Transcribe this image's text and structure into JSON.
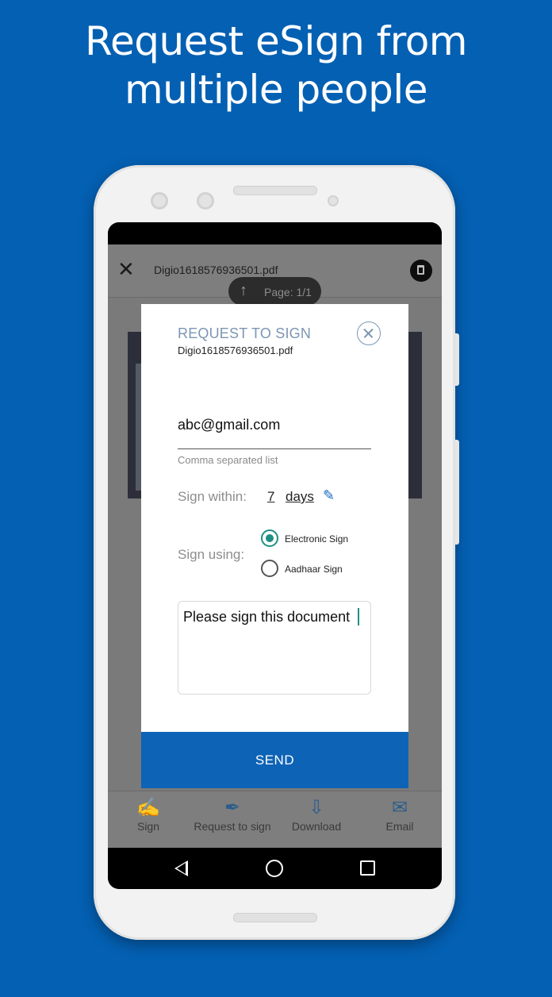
{
  "headline": {
    "line1": "Request eSign from",
    "line2": "multiple people"
  },
  "app": {
    "filename": "Digio1618576936501.pdf",
    "page_indicator": "Page: 1/1",
    "toolbar": [
      {
        "label": "Sign",
        "icon": "sign-icon"
      },
      {
        "label": "Request to sign",
        "icon": "request-sign-icon"
      },
      {
        "label": "Download",
        "icon": "download-icon"
      },
      {
        "label": "Email",
        "icon": "email-icon"
      }
    ]
  },
  "dialog": {
    "title": "REQUEST TO SIGN",
    "filename": "Digio1618576936501.pdf",
    "email_value": "abc@gmail.com",
    "email_helper": "Comma separated list",
    "sign_within_label": "Sign within:",
    "sign_within_value": "7",
    "sign_within_unit": "days",
    "sign_using_label": "Sign using:",
    "sign_options": [
      {
        "label": "Electronic Sign",
        "selected": true
      },
      {
        "label": "Aadhaar Sign",
        "selected": false
      }
    ],
    "message": "Please sign this document",
    "send_label": "SEND"
  },
  "colors": {
    "background": "#0460b3",
    "accent": "#0d63b5",
    "radio": "#1f8f82",
    "title": "#7c96b3"
  }
}
